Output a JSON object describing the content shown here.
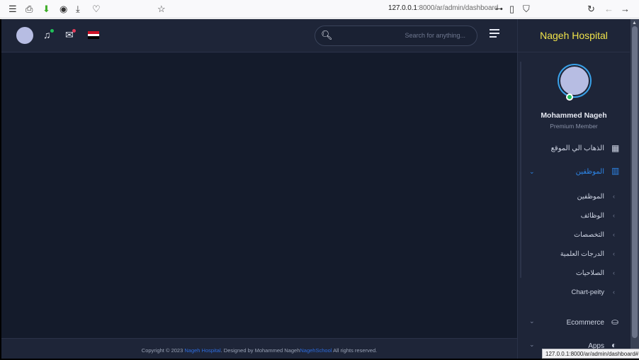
{
  "browser": {
    "url_host": "127.0.0.1",
    "url_path": ":8000/ar/admin/dashboard",
    "icons": [
      "menu-icon",
      "extensions-icon",
      "download-arrow-icon",
      "account-icon",
      "download-icon",
      "pocket-icon",
      "bookmark-star-icon",
      "key-icon",
      "page-icon",
      "shield-icon",
      "reload-icon",
      "back-icon",
      "forward-icon"
    ]
  },
  "topbar": {
    "search_placeholder": "Search for anything...",
    "notification_dot_color": "#21c15a",
    "mail_dot_color": "#e23b5a",
    "flag": [
      "#ce1126",
      "#ffffff",
      "#000000"
    ]
  },
  "sidebar": {
    "brand": "Nageh Hospital",
    "brand_color": "#f0e34a",
    "profile": {
      "name": "Mohammed Nageh",
      "role": "Premium Member"
    },
    "items": [
      {
        "label": "الذهاب الي الموقع",
        "icon": "dashboard-grid-icon"
      },
      {
        "label": "الموظفين",
        "icon": "chart-icon",
        "expanded": true
      },
      {
        "label": "Ecommerce",
        "icon": "basket-icon"
      },
      {
        "label": "Apps",
        "icon": "pie-icon"
      }
    ],
    "subitems": [
      "الموظفين",
      "الوظائف",
      "التخصصات",
      "الدرجات العلمية",
      "الصلاحيات",
      "Chart-peity"
    ]
  },
  "footer": {
    "prefix": "Copyright © 2023 ",
    "brand": "Nageh Hospital",
    "middle": ". Designed by Mohammed Nageh",
    "school": "NagehSchool",
    "suffix": " All rights reserved."
  },
  "status_url": "127.0.0.1:8000/ar/admin/dashboard#"
}
